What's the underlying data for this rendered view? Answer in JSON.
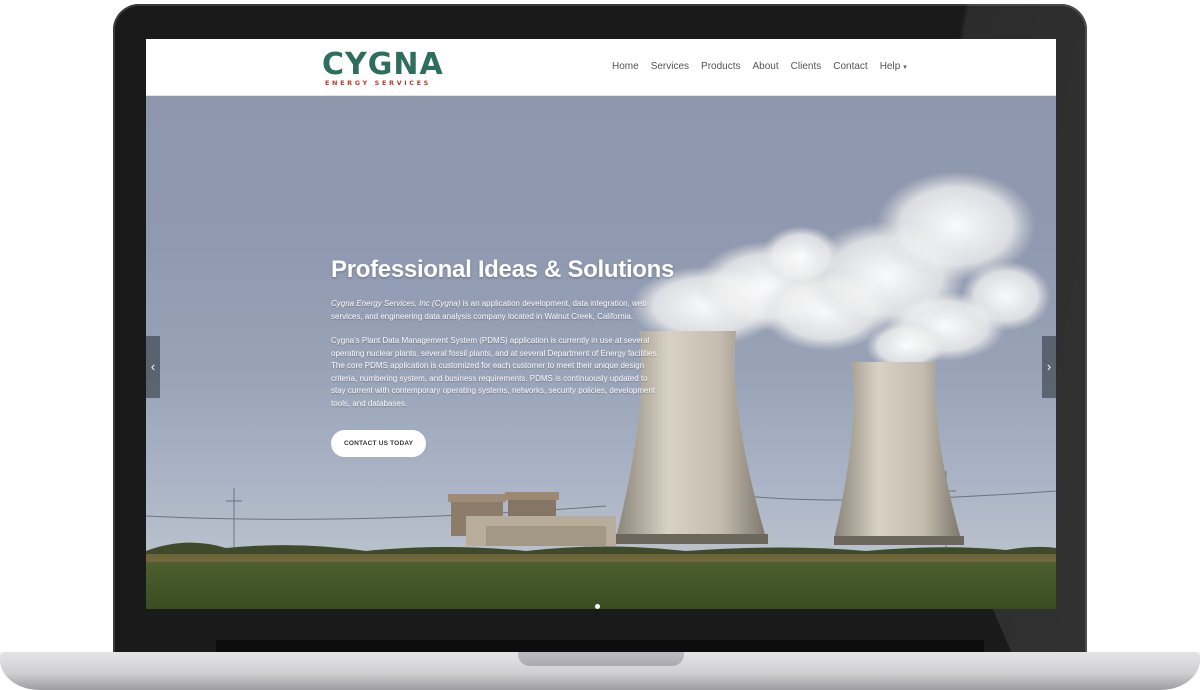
{
  "logo": {
    "name": "CYGNA",
    "tagline": "ENERGY SERVICES"
  },
  "nav": {
    "items": [
      "Home",
      "Services",
      "Products",
      "About",
      "Clients",
      "Contact"
    ],
    "help_label": "Help",
    "help_caret": "▾"
  },
  "hero": {
    "title": "Professional Ideas & Solutions",
    "para1_company": "Cygna Energy Services, Inc (Cygna)",
    "para1_rest": " is an application development, data integration, web services, and engineering data analysis company located in Walnut Creek, California.",
    "para2": "Cygna's Plant Data Management System (PDMS) application is currently in use at several operating nuclear plants, several fossil plants, and at several Department of Energy facilities. The core PDMS application is customized for each customer to meet their unique design criteria, numbering system, and business requirements. PDMS is continuously updated to stay current with contemporary operating systems, networks, security policies, development tools, and databases.",
    "cta_label": "CONTACT US TODAY",
    "prev_arrow": "‹",
    "next_arrow": "›"
  },
  "colors": {
    "logo_green": "#2e6e5e",
    "logo_red": "#c0392b",
    "sky": "#8f99b0"
  }
}
